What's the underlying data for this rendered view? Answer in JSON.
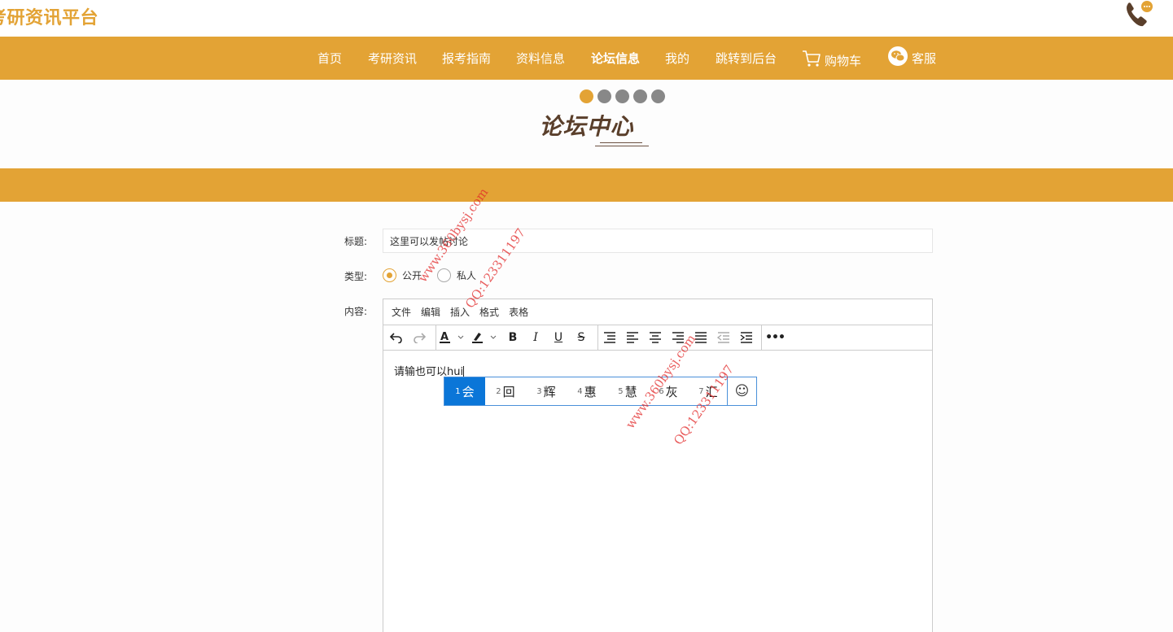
{
  "header": {
    "site_title": "考研资讯平台"
  },
  "nav": {
    "items": [
      {
        "label": "首页",
        "icon": ""
      },
      {
        "label": "考研资讯",
        "icon": ""
      },
      {
        "label": "报考指南",
        "icon": ""
      },
      {
        "label": "资料信息",
        "icon": ""
      },
      {
        "label": "论坛信息",
        "icon": "",
        "active": true
      },
      {
        "label": "我的",
        "icon": ""
      },
      {
        "label": "跳转到后台",
        "icon": ""
      },
      {
        "label": "购物车",
        "icon": "cart-icon"
      },
      {
        "label": "客服",
        "icon": "wechat-icon"
      }
    ]
  },
  "section": {
    "title": "论坛中心",
    "active_dot": 1,
    "dot_count": 5
  },
  "form": {
    "title_label": "标题:",
    "title_value": "这里可以发帖讨论",
    "type_label": "类型:",
    "type_options": [
      "公开",
      "私人"
    ],
    "type_selected": "公开",
    "content_label": "内容:"
  },
  "editor": {
    "menus": [
      "文件",
      "编辑",
      "插入",
      "格式",
      "表格"
    ],
    "content_text": "请输也可以hui"
  },
  "ime": {
    "candidates": [
      {
        "num": "1",
        "char": "会"
      },
      {
        "num": "2",
        "char": "回"
      },
      {
        "num": "3",
        "char": "辉"
      },
      {
        "num": "4",
        "char": "惠"
      },
      {
        "num": "5",
        "char": "慧"
      },
      {
        "num": "6",
        "char": "灰"
      },
      {
        "num": "7",
        "char": "汇"
      }
    ],
    "selected_index": 0
  },
  "watermark": {
    "site": "www.360bysj.com",
    "qq": "QQ:123311197"
  },
  "colors": {
    "accent": "#e3a335",
    "title_brown": "#5a3f2b",
    "ime_select": "#0b76d8",
    "watermark": "#e12828"
  }
}
